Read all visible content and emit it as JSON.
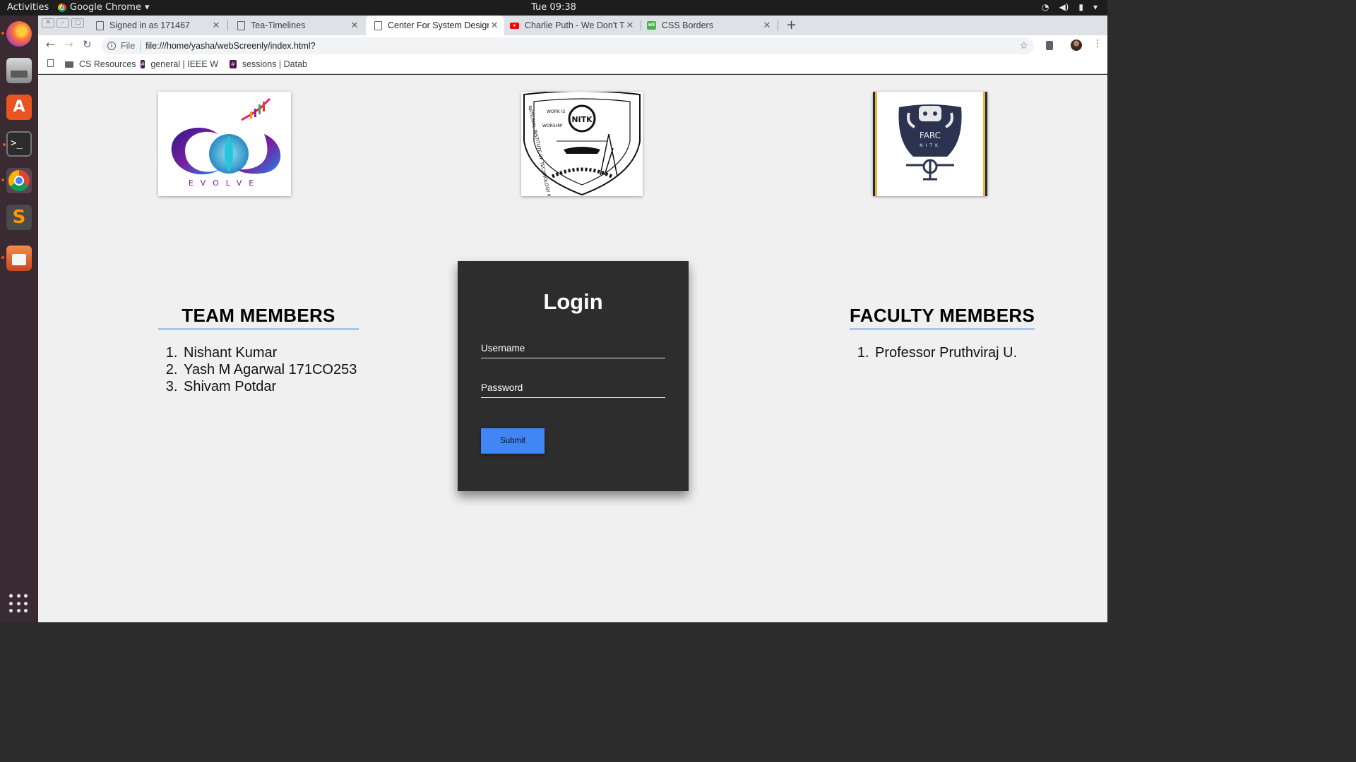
{
  "topbar": {
    "activities": "Activities",
    "app_name": "Google Chrome",
    "clock": "Tue 09:38"
  },
  "tabs": [
    {
      "title": "Signed in as 171467",
      "favicon": "page-icon"
    },
    {
      "title": "Tea-Timelines",
      "favicon": "page-icon"
    },
    {
      "title": "Center For System Design",
      "favicon": "page-icon",
      "active": true
    },
    {
      "title": "Charlie Puth - We Don't Ta",
      "favicon": "youtube-icon"
    },
    {
      "title": "CSS Borders",
      "favicon": "w3schools-icon"
    }
  ],
  "omnibox": {
    "scheme_label": "File",
    "url": "file:///home/yasha/webScreenly/index.html?"
  },
  "bookmarks": [
    {
      "label": "CS Resources",
      "icon": "folder-icon"
    },
    {
      "label": "general | IEEE W",
      "icon": "slack-icon"
    },
    {
      "label": "sessions | Datab",
      "icon": "slack-icon"
    }
  ],
  "page": {
    "logos": {
      "csd_text": "EVOLVE",
      "nitk_top_left": "WORK IS",
      "nitk_worship": "WORSHIP",
      "nitk_center": "NITK",
      "nitk_ring": "NATIONAL INSTITUTE OF TECHNOLOGY KARNATAKA, SURATHKAL",
      "farc_text": "FARC",
      "farc_sub": "NITK"
    },
    "team": {
      "title": "TEAM MEMBERS",
      "members": [
        "Nishant Kumar",
        "Yash M Agarwal 171CO253",
        "Shivam Potdar"
      ]
    },
    "login": {
      "title": "Login",
      "username_placeholder": "Username",
      "password_placeholder": "Password",
      "submit_label": "Submit"
    },
    "faculty": {
      "title": "FACULTY MEMBERS",
      "members": [
        "Professor Pruthviraj U."
      ]
    }
  },
  "colors": {
    "login_bg": "#2d2d2d",
    "submit_bg": "#4285f4",
    "heading_underline": "#a9c6e6",
    "page_bg": "#f0f0f0"
  }
}
